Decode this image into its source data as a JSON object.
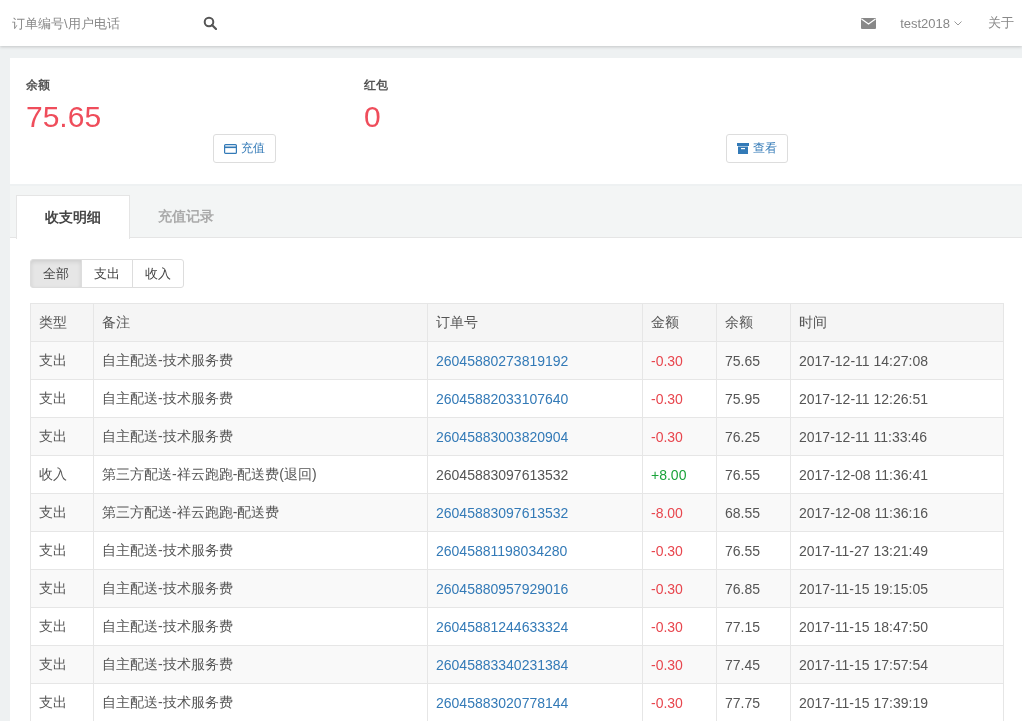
{
  "topbar": {
    "search": {
      "placeholder": "订单编号\\用户电话"
    },
    "user": "test2018",
    "about": "关于"
  },
  "summary": [
    {
      "label": "余额",
      "value": "75.65",
      "button": "充值"
    },
    {
      "label": "红包",
      "value": "0",
      "button": "查看"
    }
  ],
  "tabs": [
    {
      "label": "收支明细",
      "selected": true
    },
    {
      "label": "充值记录",
      "selected": false
    }
  ],
  "filters": [
    {
      "label": "全部",
      "selected": true
    },
    {
      "label": "支出",
      "selected": false
    },
    {
      "label": "收入",
      "selected": false
    }
  ],
  "table": {
    "columns": [
      "类型",
      "备注",
      "订单号",
      "金额",
      "余额",
      "时间"
    ],
    "rows": [
      {
        "type": "支出",
        "note": "自主配送-技术服务费",
        "order": "26045880273819192",
        "link": true,
        "amount": "-0.30",
        "color": "#e8464e",
        "balance": "75.65",
        "time": "2017-12-11 14:27:08"
      },
      {
        "type": "支出",
        "note": "自主配送-技术服务费",
        "order": "26045882033107640",
        "link": true,
        "amount": "-0.30",
        "color": "#e8464e",
        "balance": "75.95",
        "time": "2017-12-11 12:26:51"
      },
      {
        "type": "支出",
        "note": "自主配送-技术服务费",
        "order": "26045883003820904",
        "link": true,
        "amount": "-0.30",
        "color": "#e8464e",
        "balance": "76.25",
        "time": "2017-12-11 11:33:46"
      },
      {
        "type": "收入",
        "note": "第三方配送-祥云跑跑-配送费(退回)",
        "order": "26045883097613532",
        "link": false,
        "amount": "+8.00",
        "color": "#1aa33a",
        "balance": "76.55",
        "time": "2017-12-08 11:36:41"
      },
      {
        "type": "支出",
        "note": "第三方配送-祥云跑跑-配送费",
        "order": "26045883097613532",
        "link": true,
        "amount": "-8.00",
        "color": "#e8464e",
        "balance": "68.55",
        "time": "2017-12-08 11:36:16"
      },
      {
        "type": "支出",
        "note": "自主配送-技术服务费",
        "order": "26045881198034280",
        "link": true,
        "amount": "-0.30",
        "color": "#e8464e",
        "balance": "76.55",
        "time": "2017-11-27 13:21:49"
      },
      {
        "type": "支出",
        "note": "自主配送-技术服务费",
        "order": "26045880957929016",
        "link": true,
        "amount": "-0.30",
        "color": "#e8464e",
        "balance": "76.85",
        "time": "2017-11-15 19:15:05"
      },
      {
        "type": "支出",
        "note": "自主配送-技术服务费",
        "order": "26045881244633324",
        "link": true,
        "amount": "-0.30",
        "color": "#e8464e",
        "balance": "77.15",
        "time": "2017-11-15 18:47:50"
      },
      {
        "type": "支出",
        "note": "自主配送-技术服务费",
        "order": "26045883340231384",
        "link": true,
        "amount": "-0.30",
        "color": "#e8464e",
        "balance": "77.45",
        "time": "2017-11-15 17:57:54"
      },
      {
        "type": "支出",
        "note": "自主配送-技术服务费",
        "order": "26045883020778144",
        "link": true,
        "amount": "-0.30",
        "color": "#e8464e",
        "balance": "77.75",
        "time": "2017-11-15 17:39:19"
      }
    ]
  }
}
